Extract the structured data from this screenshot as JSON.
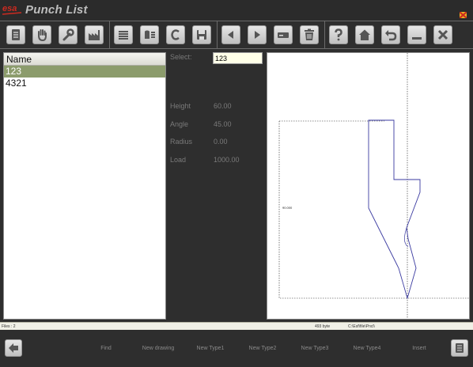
{
  "app": {
    "logo_text": "esa",
    "title": "Punch List",
    "colors": {
      "background": "#2e2e2e",
      "selection": "#8c9c6c",
      "drawing_line": "#3a3aa0",
      "brand_red": "#cc2a20"
    }
  },
  "toolbar": {
    "buttons": [
      {
        "name": "document-icon"
      },
      {
        "name": "hand-icon"
      },
      {
        "name": "wrench-icon"
      },
      {
        "name": "factory-icon"
      },
      {
        "name": "list-stack-icon"
      },
      {
        "name": "database-list-icon"
      },
      {
        "name": "c-letter-icon"
      },
      {
        "name": "save-icon"
      },
      {
        "name": "arrow-left-icon"
      },
      {
        "name": "arrow-right-icon"
      },
      {
        "name": "field-icon"
      },
      {
        "name": "trash-icon"
      },
      {
        "name": "help-icon"
      },
      {
        "name": "home-icon"
      },
      {
        "name": "undo-icon"
      },
      {
        "name": "minimize-icon"
      },
      {
        "name": "close-icon"
      }
    ]
  },
  "list": {
    "header": "Name",
    "rows": [
      "123",
      "4321"
    ],
    "selected_index": 0
  },
  "info": {
    "select_label": "Select:",
    "select_value": "123",
    "height_label": "Height",
    "height_value": "60.00",
    "angle_label": "Angle",
    "angle_value": "45.00",
    "radius_label": "Radius",
    "radius_value": "0.00",
    "load_label": "Load",
    "load_value": "1000.00"
  },
  "drawing": {
    "dimension_label": "90.000"
  },
  "status": {
    "files": "Files : 2",
    "size": "493 byte",
    "path": "C:\\Esf\\file\\Pncl\\"
  },
  "bottom": {
    "labels": [
      "Find",
      "New drawing",
      "New Type1",
      "New Type2",
      "New Type3",
      "New Type4",
      "Insert"
    ]
  }
}
